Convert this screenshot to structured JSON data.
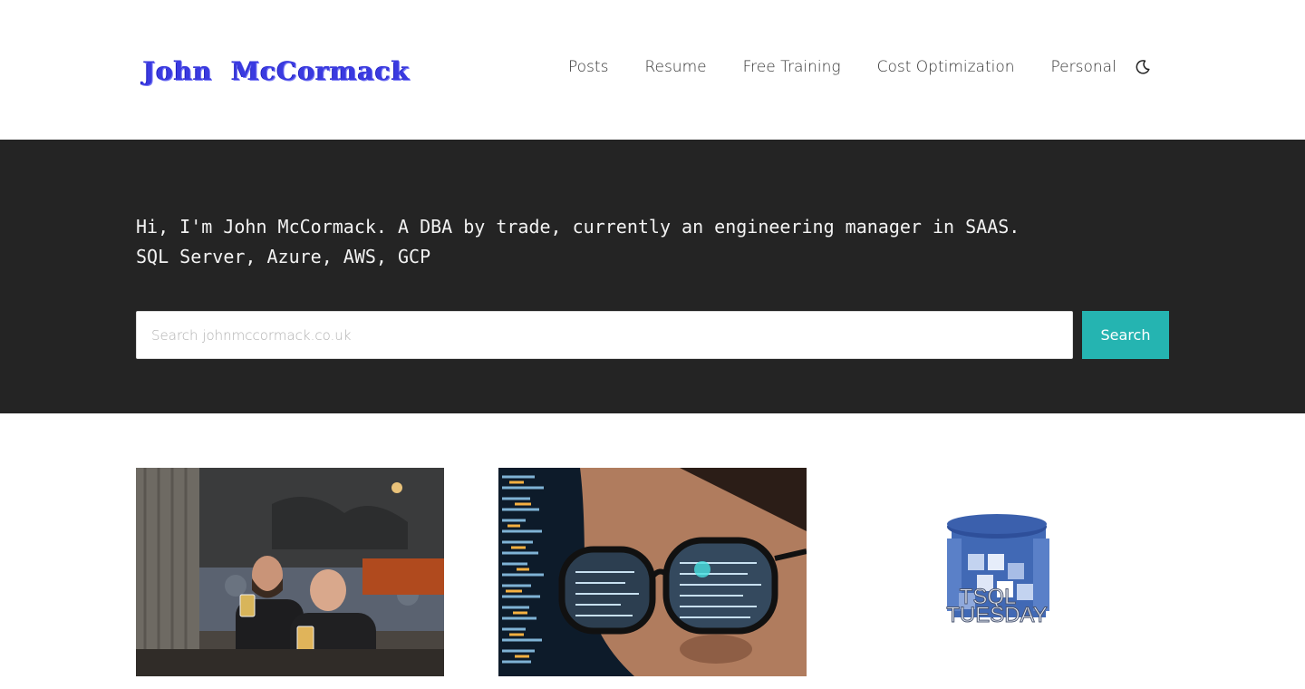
{
  "header": {
    "logo_text": "John McCormack",
    "nav": [
      {
        "label": "Posts"
      },
      {
        "label": "Resume"
      },
      {
        "label": "Free Training"
      },
      {
        "label": "Cost Optimization"
      },
      {
        "label": "Personal"
      }
    ],
    "theme_toggle_icon": "moon-icon"
  },
  "hero": {
    "tagline_line1": "Hi, I'm John McCormack. A DBA by trade, currently an engineering manager in SAAS.",
    "tagline_line2": "SQL Server, Azure, AWS, GCP",
    "search": {
      "placeholder": "Search johnmccormack.co.uk",
      "value": "",
      "button_label": "Search"
    }
  },
  "cards": [
    {
      "image": "two-men-with-beers-photo"
    },
    {
      "image": "woman-glasses-code-reflection-photo"
    },
    {
      "image": "tsql-tuesday-logo",
      "logo_text_1": "TSQL",
      "logo_text_2": "TUESDAY"
    }
  ],
  "colors": {
    "logo": "#3a3ae0",
    "hero_bg": "#242424",
    "search_button": "#25b4b1"
  }
}
